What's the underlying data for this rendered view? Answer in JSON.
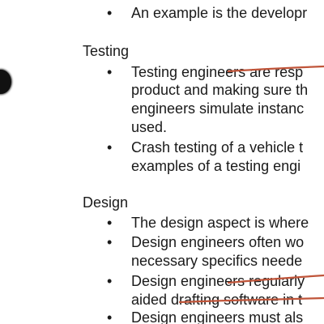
{
  "sections": [
    {
      "heading": "",
      "items": [
        {
          "lines": [
            "An example is the developr"
          ]
        }
      ]
    },
    {
      "heading": "Testing",
      "items": [
        {
          "lines": [
            "Testing engineers are resp",
            "product and making sure th",
            "engineers simulate instanc",
            "used."
          ]
        },
        {
          "lines": [
            "Crash testing of a vehicle t",
            "examples of a testing engi"
          ]
        }
      ]
    },
    {
      "heading": "Design",
      "items": [
        {
          "lines": [
            "The design aspect is where"
          ]
        },
        {
          "lines": [
            "Design engineers often wo",
            "necessary specifics neede"
          ]
        },
        {
          "lines": [
            "Design engineers regularly",
            "aided drafting software in t"
          ]
        },
        {
          "lines": [
            "Design engineers must als"
          ]
        }
      ]
    }
  ],
  "annotation_color": "#c0553a"
}
